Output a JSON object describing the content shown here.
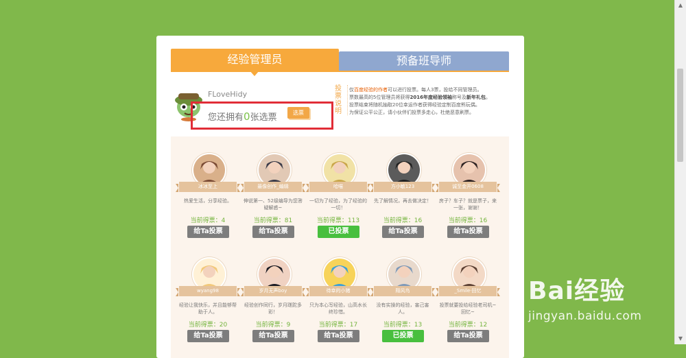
{
  "tabs": {
    "active": "经验管理员",
    "inactive": "预备班导师"
  },
  "user": {
    "name": "FLoveHidy",
    "votes_prefix": "您还拥有",
    "votes_count": "0",
    "votes_suffix": "张选票",
    "chip_label": "选票"
  },
  "rules": {
    "vertical_title": "投票说明",
    "lines": [
      [
        "仅",
        "百度经验的作者",
        "可以进行投票。每人3票，投给不同管理员。"
      ],
      [
        "票数最高的5位管理员将获得",
        "2016年度经验领袖",
        "称号及",
        "新年礼包",
        "。"
      ],
      [
        "投票结束将随机抽取20位幸运作者获得经验定制百度熊玩偶。"
      ],
      [
        "为保证公平公正，请小伙伴们投票多走心，杜绝恶意刷票。"
      ]
    ]
  },
  "score_label": "当前得票：",
  "vote_button": "给Ta投票",
  "voted_button": "已投票",
  "candidates": [
    {
      "name": "冰冰至上",
      "desc": "热爱生活，分享经验。",
      "score": "4",
      "voted": false
    },
    {
      "name": "最像创作_编辑",
      "desc": "伸说第一、52级编导为您答疑解惑~",
      "score": "81",
      "voted": false
    },
    {
      "name": "哈喵",
      "desc": "一切为了经验，为了经验的一切！",
      "score": "113",
      "voted": true
    },
    {
      "name": "方小敏123",
      "desc": "先了解情况，再去做决定！",
      "score": "16",
      "voted": false
    },
    {
      "name": "诚至金开0608",
      "desc": "房子？车子？就是票子，来一张，谢谢！",
      "score": "16",
      "voted": false
    },
    {
      "name": "wyang98",
      "desc": "经验让我快乐，并且能够帮助于人。",
      "score": "20",
      "voted": false
    },
    {
      "name": "岁月无声boy",
      "desc": "经验创作同行，岁月蹉跎多彩！",
      "score": "9",
      "voted": false
    },
    {
      "name": "待幸的小猪",
      "desc": "只为本心写经验，山高水长终珍惜。",
      "score": "17",
      "voted": false
    },
    {
      "name": "翔风鸟",
      "desc": "没有实操的经验，害己害人。",
      "score": "13",
      "voted": true
    },
    {
      "name": "_Smile·回忆",
      "desc": "投票就要投给经验老司机~回忆~",
      "score": "12",
      "voted": false
    }
  ],
  "watermark": {
    "logo": "Bai经验",
    "url": "jingyan.baidu.com"
  },
  "colors": {
    "page_bg": "#80b84b",
    "accent": "#f7a93c",
    "secondary_tab": "#8fa7cf",
    "vote_button": "#7d7d7d",
    "voted_button": "#48bf3e",
    "score": "#74b43e",
    "highlight_box": "#e12d37"
  }
}
